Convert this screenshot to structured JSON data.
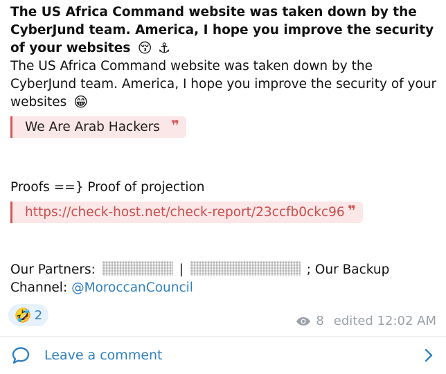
{
  "post": {
    "title": "The US Africa Command website was taken down by the CyberJund team. America, I hope you improve the security of your websites",
    "title_emojis": [
      "😚",
      "⚓"
    ],
    "subtitle": "The US Africa Command website was taken down by the CyberJund team. America, I hope you improve the security of your websites",
    "subtitle_emoji": "😁",
    "quote_arab": "We Are Arab Hackers",
    "quote_mark": "❞",
    "proofs_label": "Proofs ==} Proof of projection",
    "proof_link": "https://check-host.net/check-report/23ccfb0ckc96",
    "partners_label": "Our Partners:",
    "partners_separator": "|",
    "backup_label": "; Our Backup Channel:",
    "backup_channel": "@MoroccanCouncil"
  },
  "reaction": {
    "emoji": "🤣",
    "count": "2"
  },
  "meta": {
    "views_icon": "eye-icon",
    "views": "8",
    "edited": "edited 12:02 AM"
  },
  "comments": {
    "label": "Leave a comment",
    "icon": "comment-icon",
    "chevron_icon": "chevron-right-icon"
  },
  "colors": {
    "accent_blue": "#2f7fc1",
    "quote_red": "#d35656",
    "quote_bg": "#fbe7e7",
    "meta_gray": "#9aa1a8"
  }
}
